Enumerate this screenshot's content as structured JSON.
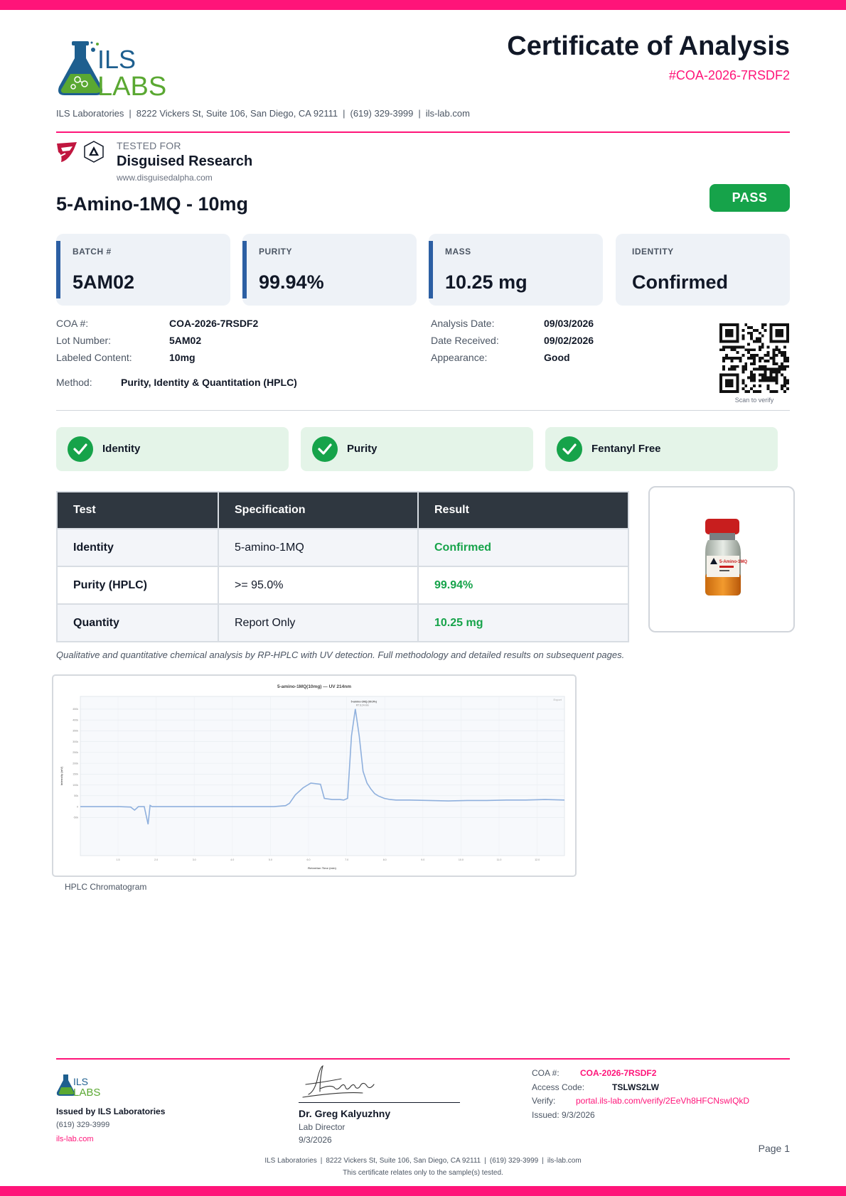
{
  "header": {
    "logo_text_top": "ILS",
    "logo_text_bottom": "LABS",
    "title": "Certificate of Analysis",
    "certificate_id": "#COA-2026-7RSDF2",
    "address_line": [
      "ILS Laboratories",
      "8222 Vickers St, Suite 106, San Diego, CA 92111",
      "(619) 329-3999",
      "ils-lab.com"
    ]
  },
  "client": {
    "tested_for_label": "TESTED FOR",
    "name": "Disguised Research",
    "website": "www.disguisedalpha.com"
  },
  "product": {
    "name": "5-Amino-1MQ - 10mg",
    "status": "PASS"
  },
  "stats": [
    {
      "label": "BATCH #",
      "value": "5AM02"
    },
    {
      "label": "PURITY",
      "value": "99.94%"
    },
    {
      "label": "MASS",
      "value": "10.25 mg"
    },
    {
      "label": "IDENTITY",
      "value": "Confirmed"
    }
  ],
  "details": {
    "left": [
      {
        "label": "COA #:",
        "value": "COA-2026-7RSDF2"
      },
      {
        "label": "Lot Number:",
        "value": "5AM02"
      },
      {
        "label": "Labeled Content:",
        "value": "10mg"
      }
    ],
    "right": [
      {
        "label": "Analysis Date:",
        "value": "09/03/2026"
      },
      {
        "label": "Date Received:",
        "value": "09/02/2026"
      },
      {
        "label": "Appearance:",
        "value": "Good"
      }
    ],
    "method_label": "Method:",
    "method_value": "Purity, Identity & Quantitation (HPLC)",
    "qr_caption": "Scan to verify"
  },
  "checks": [
    "Identity",
    "Purity",
    "Fentanyl Free"
  ],
  "results_table": {
    "headers": [
      "Test",
      "Specification",
      "Result"
    ],
    "rows": [
      {
        "test": "Identity",
        "spec": "5-amino-1MQ",
        "result": "Confirmed"
      },
      {
        "test": "Purity (HPLC)",
        "spec": ">= 95.0%",
        "result": "99.94%"
      },
      {
        "test": "Quantity",
        "spec": "Report Only",
        "result": "10.25 mg"
      }
    ]
  },
  "vial": {
    "label_text": "5-Amino-1MQ",
    "cap_color": "#c81e1e"
  },
  "method_note": "Qualitative and quantitative chemical analysis by RP-HPLC with UV detection. Full methodology and detailed results on subsequent pages.",
  "chart_data": {
    "type": "line",
    "title": "5-amino-1MQ(10mg) — UV 214nm",
    "xlabel": "Retention Time (min)",
    "ylabel": "Intensity (mV)",
    "legend": "Export",
    "xlim": [
      0,
      12.7
    ],
    "ylim": [
      -190,
      450
    ],
    "xticks": [
      "1.5",
      "2.0",
      "3.0",
      "4.0",
      "5.0",
      "6.0",
      "7.0",
      "8.0",
      "9.0",
      "10.0",
      "11.0",
      "12.0"
    ],
    "yticks": [
      "450k",
      "400k",
      "350k",
      "300k",
      "250k",
      "200k",
      "150k",
      "100k",
      "50k",
      "0",
      "-50k"
    ],
    "peak_label": "5-amino-1MQ (99.9%)",
    "peak_sublabel": "RT: 8.24 min",
    "series": [
      {
        "x": [
          0,
          1.0,
          2.0,
          2.6,
          2.8,
          3.0,
          3.3,
          3.5,
          3.6,
          3.7,
          4.0,
          5.0,
          6.0,
          7.0,
          8.0,
          9.0,
          9.6,
          10.0,
          10.6,
          10.8,
          11.1,
          11.5,
          11.9,
          12.4,
          12.6,
          13.0,
          13.4,
          13.6,
          13.8,
          14.0,
          14.2,
          14.4,
          14.6,
          14.8,
          15.0,
          15.2,
          15.4,
          15.7,
          16.0,
          16.3,
          16.6,
          17.0,
          18.0,
          19.0,
          20.0,
          21.0,
          22.0,
          23.0,
          24.0,
          25.0
        ],
        "y": [
          0,
          0,
          0,
          -2,
          -15,
          0,
          0,
          -75,
          5,
          0,
          0,
          0,
          0,
          0,
          0,
          0,
          0,
          0,
          4,
          14,
          50,
          80,
          100,
          95,
          35,
          30,
          30,
          28,
          35,
          300,
          415,
          300,
          150,
          100,
          75,
          55,
          45,
          35,
          30,
          28,
          28,
          28,
          26,
          24,
          26,
          26,
          28,
          28,
          30,
          28
        ]
      }
    ]
  },
  "chromatogram_caption": "HPLC Chromatogram",
  "footer": {
    "issued_by": "Issued by ILS Laboratories",
    "phone": "(619) 329-3999",
    "web": "ils-lab.com",
    "signer_name": "Dr. Greg Kalyuzhny",
    "signer_role": "Lab Director",
    "sign_date": "9/3/2026",
    "coa_label": "COA #:",
    "coa_value": "COA-2026-7RSDF2",
    "access_label": "Access Code:",
    "access_value": "TSLWS2LW",
    "verify_label": "Verify:",
    "verify_value": "portal.ils-lab.com/verify/2EeVh8HFCNswIQkD",
    "issued_line": "Issued: 9/3/2026",
    "page": "Page 1",
    "address_line": [
      "ILS Laboratories",
      "8222 Vickers St, Suite 106, San Diego, CA 92111",
      "(619) 329-3999",
      "ils-lab.com"
    ],
    "note": "This certificate relates only to the sample(s) tested."
  },
  "colors": {
    "brand_pink": "#ff1479",
    "pass_green": "#16a34a",
    "card_accent": "#2c5fa3",
    "table_header": "#2f3740",
    "logo_blue": "#1e5f8f",
    "logo_green": "#5aa832"
  }
}
